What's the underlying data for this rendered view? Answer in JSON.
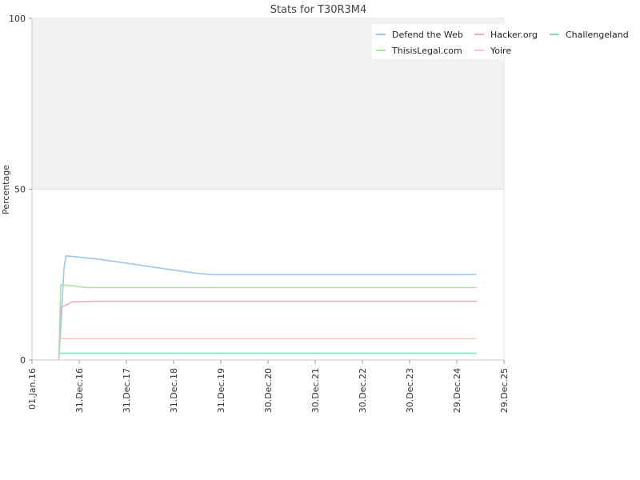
{
  "chart_data": {
    "type": "line",
    "title": "Stats for T30R3M4",
    "xlabel": "",
    "ylabel": "Percentage",
    "ylim": [
      0,
      100
    ],
    "yticks": [
      "0",
      "50",
      "100"
    ],
    "xlim": [
      "2016-01-01",
      "2025-12-29"
    ],
    "xticks": [
      {
        "date": "2016-01-01",
        "label": "01.Jan.16"
      },
      {
        "date": "2016-12-31",
        "label": "31.Dec.16"
      },
      {
        "date": "2017-12-31",
        "label": "31.Dec.17"
      },
      {
        "date": "2018-12-31",
        "label": "31.Dec.18"
      },
      {
        "date": "2019-12-31",
        "label": "31.Dec.19"
      },
      {
        "date": "2020-12-30",
        "label": "30.Dec.20"
      },
      {
        "date": "2021-12-30",
        "label": "30.Dec.21"
      },
      {
        "date": "2022-12-30",
        "label": "30.Dec.22"
      },
      {
        "date": "2023-12-30",
        "label": "30.Dec.23"
      },
      {
        "date": "2024-12-29",
        "label": "29.Dec.24"
      },
      {
        "date": "2025-12-29",
        "label": "29.Dec.25"
      }
    ],
    "upper_band": {
      "from": 50,
      "to": 100,
      "color": "#f2f2f2"
    },
    "legend_position": "top-right",
    "series": [
      {
        "name": "Defend the Web",
        "color": "#9fc5e8",
        "points": [
          [
            "2016-07-27",
            0
          ],
          [
            "2016-08-03",
            5
          ],
          [
            "2016-08-12",
            10
          ],
          [
            "2016-08-25",
            20
          ],
          [
            "2016-09-05",
            27
          ],
          [
            "2016-09-20",
            30.5
          ],
          [
            "2017-06-01",
            29.5
          ],
          [
            "2018-06-01",
            27.5
          ],
          [
            "2019-06-01",
            25.5
          ],
          [
            "2019-10-15",
            25
          ],
          [
            "2025-05-30",
            25
          ]
        ]
      },
      {
        "name": "Hacker.org",
        "color": "#f4a6c6",
        "points": [
          [
            "2016-07-27",
            0
          ],
          [
            "2016-08-05",
            12
          ],
          [
            "2016-08-15",
            15.5
          ],
          [
            "2016-09-15",
            16
          ],
          [
            "2016-10-15",
            16.5
          ],
          [
            "2016-11-01",
            17
          ],
          [
            "2017-05-01",
            17.2
          ],
          [
            "2025-05-30",
            17.2
          ]
        ]
      },
      {
        "name": "Challengeland",
        "color": "#7fe0c8",
        "points": [
          [
            "2016-07-27",
            2
          ],
          [
            "2025-05-30",
            2
          ]
        ]
      },
      {
        "name": "ThisisLegal.com",
        "color": "#a8e6a1",
        "points": [
          [
            "2016-07-27",
            0
          ],
          [
            "2016-08-10",
            22
          ],
          [
            "2016-11-01",
            21.8
          ],
          [
            "2017-03-01",
            21.2
          ],
          [
            "2025-05-30",
            21.2
          ]
        ]
      },
      {
        "name": "Yoire",
        "color": "#f7c7b8",
        "points": [
          [
            "2016-07-27",
            6.2
          ],
          [
            "2025-05-30",
            6.2
          ]
        ]
      }
    ]
  }
}
